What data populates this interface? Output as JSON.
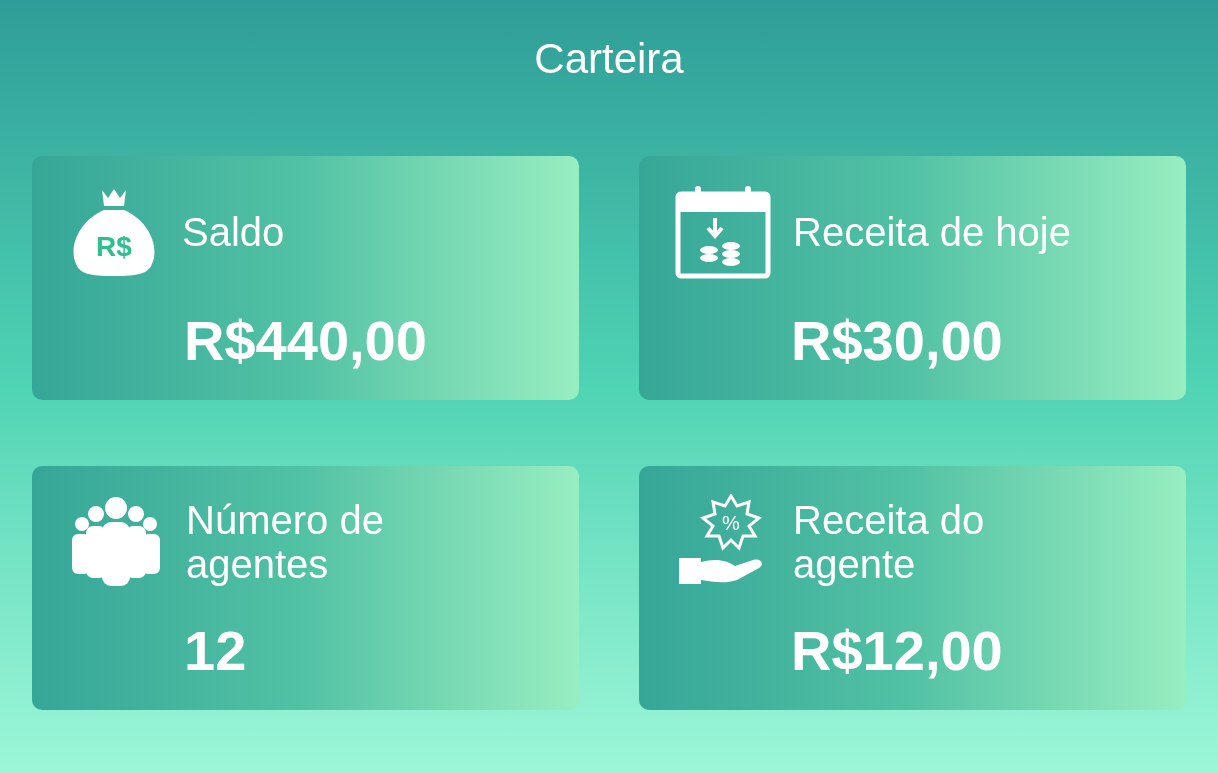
{
  "title": "Carteira",
  "cards": [
    {
      "kind": "money-bag",
      "label": "Saldo",
      "value": "R$440,00",
      "badge": "R$"
    },
    {
      "kind": "calendar",
      "label": "Receita de hoje",
      "value": "R$30,00"
    },
    {
      "kind": "people",
      "label": "Número de agentes",
      "value": "12"
    },
    {
      "kind": "hand-percent",
      "label": "Receita do agente",
      "value": "R$12,00",
      "badge": "%"
    }
  ]
}
